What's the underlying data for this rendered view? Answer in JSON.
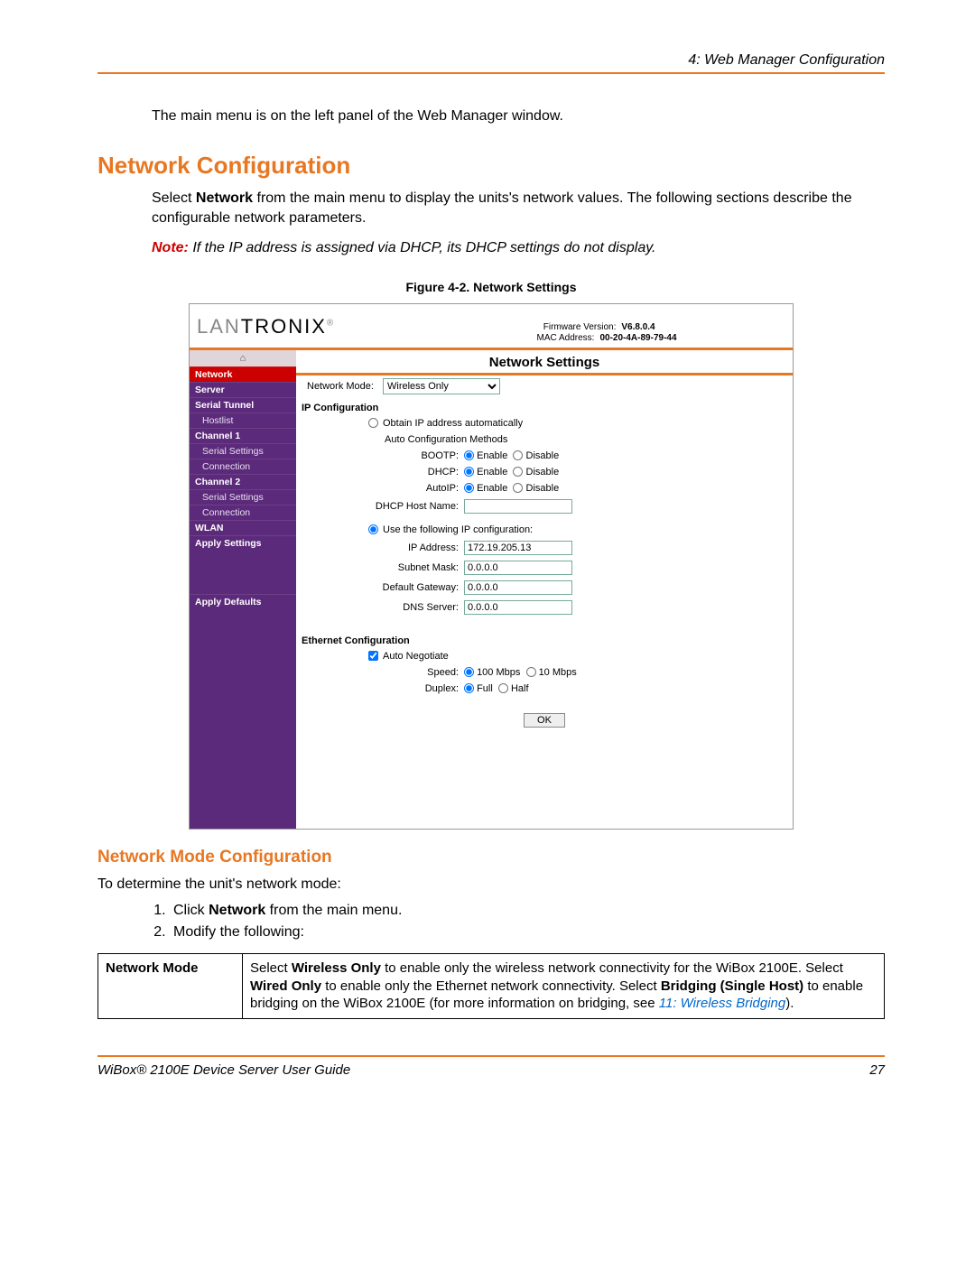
{
  "header": {
    "chapter": "4: Web Manager Configuration"
  },
  "intro": "The main menu is on the left panel of the Web Manager window.",
  "section_title": "Network Configuration",
  "section_body_prefix": "Select ",
  "section_body_bold": "Network",
  "section_body_suffix": " from the main menu to display the units's network values. The following sections describe the configurable network parameters.",
  "note": {
    "label": "Note:",
    "text": "If the IP address is assigned via DHCP, its DHCP settings do not display."
  },
  "figure_caption": "Figure 4-2. Network Settings",
  "screenshot": {
    "logo_gray": "LAN",
    "logo_black": "TRONIX",
    "logo_r": "®",
    "firmware_label": "Firmware Version:",
    "firmware_value": "V6.8.0.4",
    "mac_label": "MAC Address:",
    "mac_value": "00-20-4A-89-79-44",
    "page_title": "Network Settings",
    "home_icon": "⌂",
    "sidebar": [
      {
        "label": "Network",
        "type": "sel"
      },
      {
        "label": "Server",
        "type": "bold"
      },
      {
        "label": "Serial Tunnel",
        "type": "bold"
      },
      {
        "label": "Hostlist",
        "type": "sub"
      },
      {
        "label": "Channel 1",
        "type": "bold"
      },
      {
        "label": "Serial Settings",
        "type": "sub"
      },
      {
        "label": "Connection",
        "type": "sub"
      },
      {
        "label": "Channel 2",
        "type": "bold"
      },
      {
        "label": "Serial Settings",
        "type": "sub"
      },
      {
        "label": "Connection",
        "type": "sub"
      },
      {
        "label": "WLAN",
        "type": "bold"
      },
      {
        "label": "Apply Settings",
        "type": "bold"
      },
      {
        "label": "",
        "type": "spacer"
      },
      {
        "label": "Apply Defaults",
        "type": "bold"
      }
    ],
    "network_mode_label": "Network Mode:",
    "network_mode_value": "Wireless Only",
    "ip_config_header": "IP Configuration",
    "auto_ip": "Obtain IP address automatically",
    "auto_methods": "Auto Configuration Methods",
    "bootp": "BOOTP:",
    "dhcp": "DHCP:",
    "autoip": "AutoIP:",
    "enable": "Enable",
    "disable": "Disable",
    "dhcp_host_label": "DHCP Host Name:",
    "use_following": "Use the following IP configuration:",
    "ip_addr_label": "IP Address:",
    "ip_addr": "172.19.205.13",
    "subnet_label": "Subnet Mask:",
    "subnet": "0.0.0.0",
    "gateway_label": "Default Gateway:",
    "gateway": "0.0.0.0",
    "dns_label": "DNS Server:",
    "dns": "0.0.0.0",
    "eth_header": "Ethernet Configuration",
    "auto_neg": "Auto Negotiate",
    "speed_label": "Speed:",
    "speed_100": "100 Mbps",
    "speed_10": "10 Mbps",
    "duplex_label": "Duplex:",
    "duplex_full": "Full",
    "duplex_half": "Half",
    "ok": "OK"
  },
  "subsection_title": "Network Mode Configuration",
  "mode_intro": "To determine the unit's network mode:",
  "steps": {
    "s1a": "Click ",
    "s1b": "Network",
    "s1c": " from the main menu.",
    "s2": "Modify the following:"
  },
  "table": {
    "key": "Network Mode",
    "val_p1": "Select ",
    "val_b1": "Wireless Only",
    "val_p2": " to enable only the wireless network connectivity for the WiBox 2100E. Select ",
    "val_b2": "Wired Only",
    "val_p3": " to enable only the Ethernet network connectivity. Select ",
    "val_b3": "Bridging (Single Host)",
    "val_p4": " to enable bridging on the WiBox 2100E (for more information on bridging, see ",
    "val_link": "11: Wireless Bridging",
    "val_p5": ")."
  },
  "footer": {
    "left": "WiBox® 2100E Device Server User Guide",
    "right": "27"
  }
}
